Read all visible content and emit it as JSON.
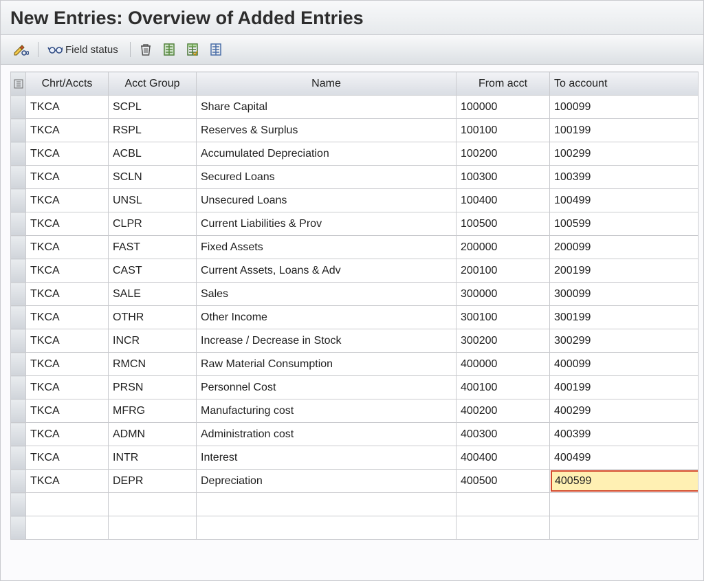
{
  "title": "New Entries: Overview of Added Entries",
  "toolbar": {
    "field_status_label": "Field status"
  },
  "table": {
    "headers": {
      "chart_accounts": "Chrt/Accts",
      "account_group": "Acct Group",
      "name": "Name",
      "from_account": "From acct",
      "to_account": "To account"
    },
    "rows": [
      {
        "chrt": "TKCA",
        "grp": "SCPL",
        "name": "Share Capital",
        "from": "100000",
        "to": "100099"
      },
      {
        "chrt": "TKCA",
        "grp": "RSPL",
        "name": "Reserves & Surplus",
        "from": "100100",
        "to": "100199"
      },
      {
        "chrt": "TKCA",
        "grp": "ACBL",
        "name": "Accumulated Depreciation",
        "from": "100200",
        "to": "100299"
      },
      {
        "chrt": "TKCA",
        "grp": "SCLN",
        "name": "Secured Loans",
        "from": "100300",
        "to": "100399"
      },
      {
        "chrt": "TKCA",
        "grp": "UNSL",
        "name": "Unsecured Loans",
        "from": "100400",
        "to": "100499"
      },
      {
        "chrt": "TKCA",
        "grp": "CLPR",
        "name": "Current Liabilities & Prov",
        "from": "100500",
        "to": "100599"
      },
      {
        "chrt": "TKCA",
        "grp": "FAST",
        "name": "Fixed Assets",
        "from": "200000",
        "to": "200099"
      },
      {
        "chrt": "TKCA",
        "grp": "CAST",
        "name": "Current Assets, Loans & Adv",
        "from": "200100",
        "to": "200199"
      },
      {
        "chrt": "TKCA",
        "grp": "SALE",
        "name": "Sales",
        "from": "300000",
        "to": "300099"
      },
      {
        "chrt": "TKCA",
        "grp": "OTHR",
        "name": "Other Income",
        "from": "300100",
        "to": "300199"
      },
      {
        "chrt": "TKCA",
        "grp": "INCR",
        "name": "Increase / Decrease in Stock",
        "from": "300200",
        "to": "300299"
      },
      {
        "chrt": "TKCA",
        "grp": "RMCN",
        "name": "Raw Material Consumption",
        "from": "400000",
        "to": "400099"
      },
      {
        "chrt": "TKCA",
        "grp": "PRSN",
        "name": "Personnel Cost",
        "from": "400100",
        "to": "400199"
      },
      {
        "chrt": "TKCA",
        "grp": "MFRG",
        "name": "Manufacturing cost",
        "from": "400200",
        "to": "400299"
      },
      {
        "chrt": "TKCA",
        "grp": "ADMN",
        "name": "Administration cost",
        "from": "400300",
        "to": "400399"
      },
      {
        "chrt": "TKCA",
        "grp": "INTR",
        "name": "Interest",
        "from": "400400",
        "to": "400499"
      },
      {
        "chrt": "TKCA",
        "grp": "DEPR",
        "name": "Depreciation",
        "from": "400500",
        "to": "400599",
        "editing_to": true
      }
    ],
    "blank_tail_rows": 2
  }
}
